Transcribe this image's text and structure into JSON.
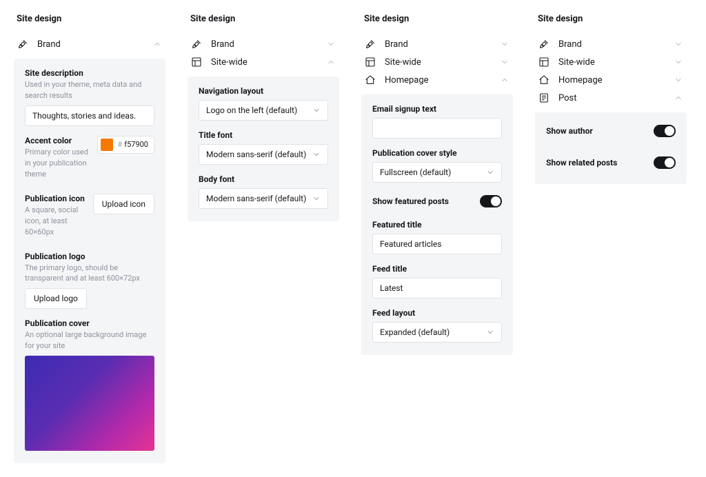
{
  "title": "Site design",
  "sections": {
    "brand": "Brand",
    "sitewide": "Site-wide",
    "homepage": "Homepage",
    "post": "Post"
  },
  "brand_panel": {
    "site_description": {
      "label": "Site description",
      "sub": "Used in your theme, meta data and search results",
      "value": "Thoughts, stories and ideas."
    },
    "accent_color": {
      "label": "Accent color",
      "sub": "Primary color used in your publication theme",
      "hex": "f57900",
      "color": "#f57900"
    },
    "publication_icon": {
      "label": "Publication icon",
      "sub": "A square, social icon, at least 60×60px",
      "button": "Upload icon"
    },
    "publication_logo": {
      "label": "Publication logo",
      "sub": "The primary logo, should be transparent and at least 600×72px",
      "button": "Upload logo"
    },
    "publication_cover": {
      "label": "Publication cover",
      "sub": "An optional large background image for your site"
    }
  },
  "sitewide_panel": {
    "nav_layout": {
      "label": "Navigation layout",
      "value": "Logo on the left (default)"
    },
    "title_font": {
      "label": "Title font",
      "value": "Modern sans-serif (default)"
    },
    "body_font": {
      "label": "Body font",
      "value": "Modern sans-serif (default)"
    }
  },
  "homepage_panel": {
    "email_signup": {
      "label": "Email signup text",
      "value": ""
    },
    "cover_style": {
      "label": "Publication cover style",
      "value": "Fullscreen (default)"
    },
    "show_featured": {
      "label": "Show featured posts",
      "on": true
    },
    "featured_title": {
      "label": "Featured title",
      "value": "Featured articles"
    },
    "feed_title": {
      "label": "Feed title",
      "value": "Latest"
    },
    "feed_layout": {
      "label": "Feed layout",
      "value": "Expanded (default)"
    }
  },
  "post_panel": {
    "show_author": {
      "label": "Show author",
      "on": true
    },
    "show_related": {
      "label": "Show related posts",
      "on": true
    }
  }
}
